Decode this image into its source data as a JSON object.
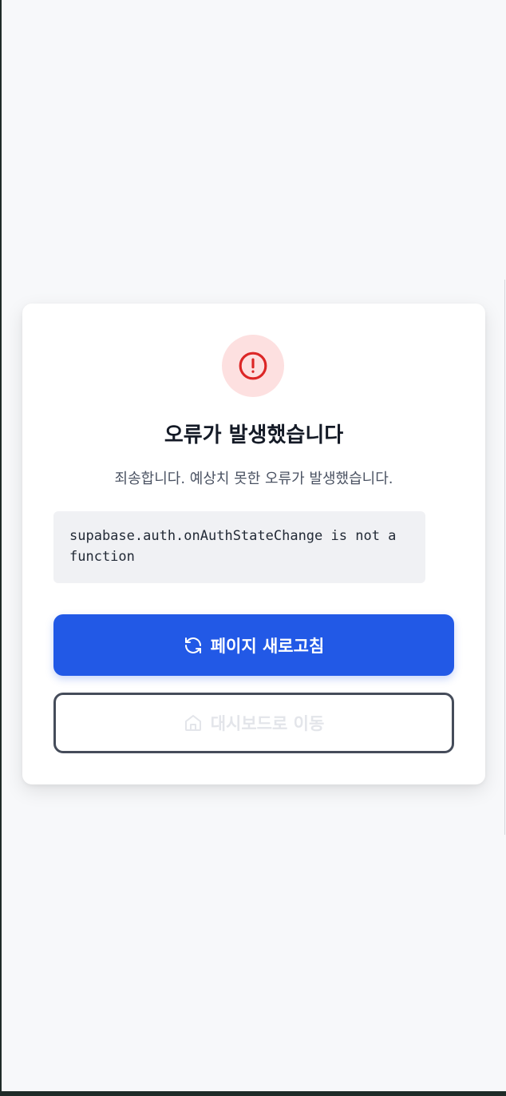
{
  "error_card": {
    "title": "오류가 발생했습니다",
    "subtitle": "죄송합니다. 예상치 못한 오류가 발생했습니다.",
    "error_message": "supabase.auth.onAuthStateChange is not a function",
    "refresh_label": "페이지 새로고침",
    "dashboard_label": "대시보드로 이동"
  },
  "colors": {
    "primary": "#2259e6",
    "error": "#dc2626",
    "error_bg": "#fde0e0"
  }
}
